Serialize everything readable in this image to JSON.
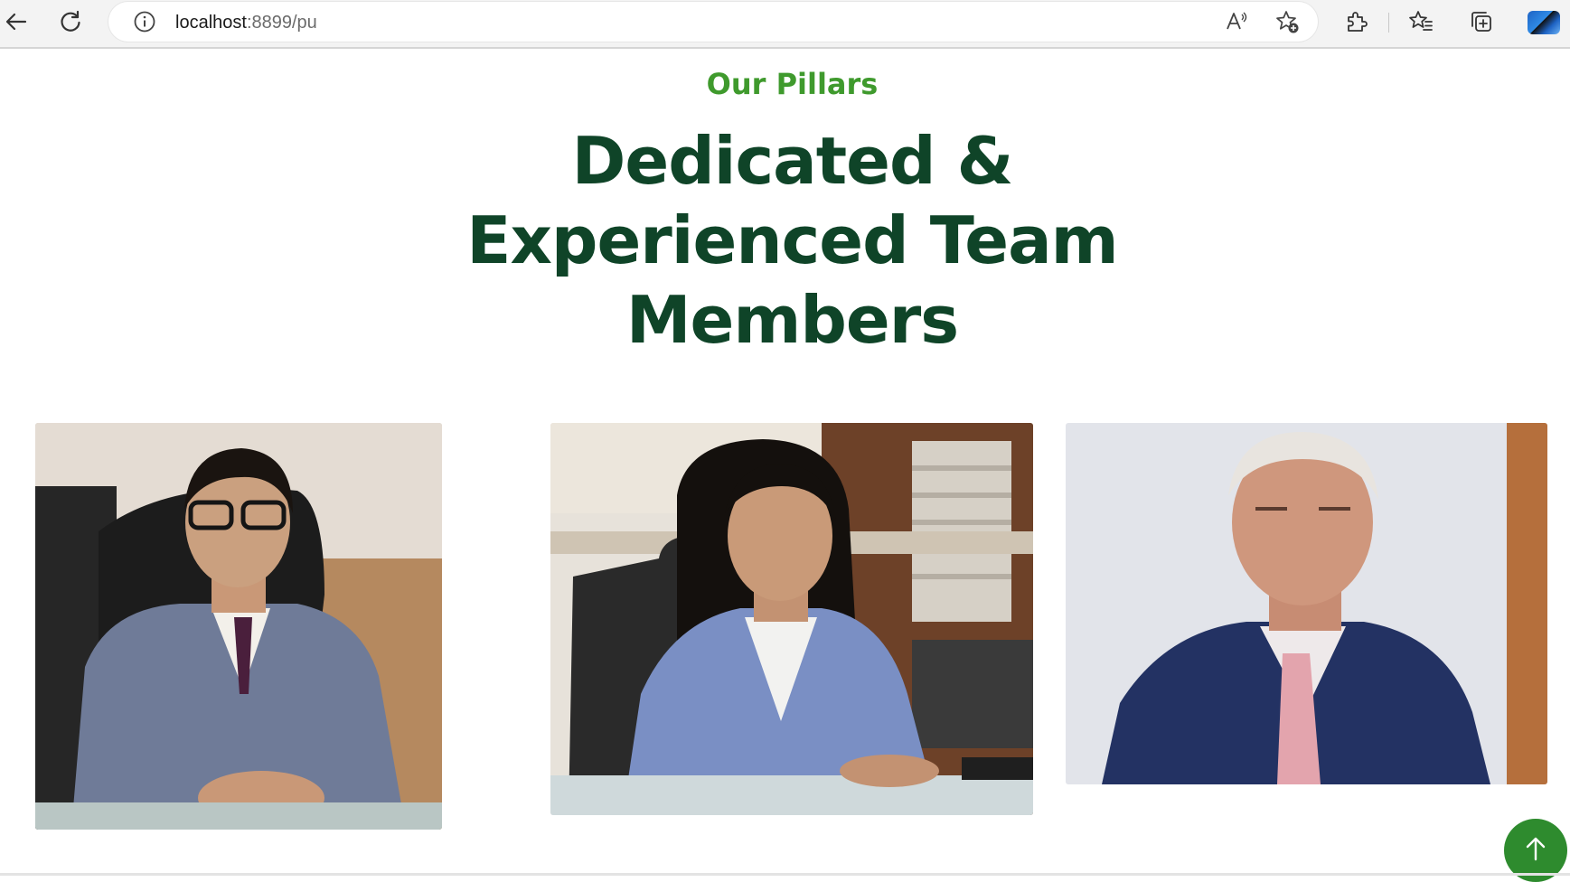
{
  "browser": {
    "url_host": "localhost",
    "url_rest": ":8899/pu"
  },
  "section": {
    "eyebrow": "Our Pillars",
    "heading_lines": [
      "Dedicated &",
      "Experienced Team",
      "Members"
    ]
  },
  "colors": {
    "eyebrow": "#3f9a2d",
    "heading": "#0f4428",
    "back_to_top": "#2e8b2e"
  },
  "icons": [
    "back-arrow-icon",
    "refresh-icon",
    "info-icon",
    "read-aloud-icon",
    "add-favorite-icon",
    "extensions-icon",
    "favorites-icon",
    "collections-icon",
    "profile-avatar",
    "arrow-up-icon"
  ]
}
